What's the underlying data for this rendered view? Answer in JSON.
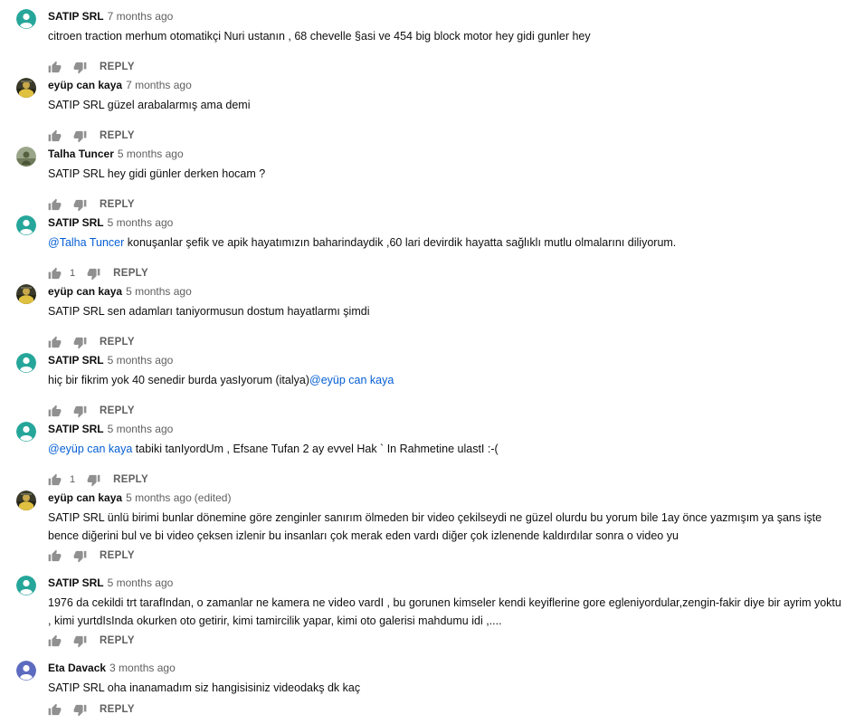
{
  "reply_label": "REPLY",
  "colors": {
    "teal_avatar": "#26a69a",
    "purple_avatar": "#5c6bc0",
    "mention": "#065fd4"
  },
  "comments": [
    {
      "author": "SATIP SRL",
      "time": "7 months ago",
      "avatar": "teal-default",
      "text_before": "citroen traction merhum otomatikçi Nuri ustanın , 68 chevelle §asi ve 454 big block motor hey gidi gunler hey"
    },
    {
      "author": "eyüp can kaya",
      "time": "7 months ago",
      "avatar": "photo-dark",
      "text_before": "SATIP SRL güzel arabalarmış ama demi"
    },
    {
      "author": "Talha Tuncer",
      "time": "5 months ago",
      "avatar": "photo-green",
      "text_before": "SATIP SRL hey gidi günler derken hocam ?"
    },
    {
      "author": "SATIP SRL",
      "time": "5 months ago",
      "avatar": "teal-default",
      "mention": "@Talha Tuncer",
      "text_after": " konuşanlar şefik ve apik hayatımızın baharindaydik ,60 lari devirdik hayatta sağlıklı mutlu olmalarını diliyorum.",
      "likes": "1"
    },
    {
      "author": "eyüp can kaya",
      "time": "5 months ago",
      "avatar": "photo-dark",
      "text_before": "SATIP SRL sen adamları taniyormusun dostum hayatlarmı şimdi"
    },
    {
      "author": "SATIP SRL",
      "time": "5 months ago",
      "avatar": "teal-default",
      "text_before": "hiç bir fikrim yok  40 senedir burda yasIyorum (italya)",
      "mention": "@eyüp can kaya"
    },
    {
      "author": "SATIP SRL",
      "time": "5 months ago",
      "avatar": "teal-default",
      "mention": "@eyüp can kaya",
      "text_after": " tabiki tanIyordUm , Efsane Tufan 2 ay evvel Hak ` In Rahmetine ulastI :-(",
      "likes": "1"
    },
    {
      "author": "eyüp can kaya",
      "time": "5 months ago",
      "edited": "(edited)",
      "avatar": "photo-dark",
      "text_before": "SATIP SRL ünlü birimi bunlar dönemine göre zenginler sanırım ölmeden bir video çekilseydi ne güzel olurdu bu yorum bile 1ay önce yazmışım ya şans işte bence diğerini bul ve bi video çeksen izlenir bu insanları çok merak eden vardı diğer çok izlenende kaldırdılar sonra o video yu"
    },
    {
      "author": "SATIP SRL",
      "time": "5 months ago",
      "avatar": "teal-default",
      "text_before": "1976 da cekildi  trt tarafIndan, o zamanlar ne kamera ne video vardI , bu gorunen kimseler kendi keyiflerine gore egleniyordular,zengin-fakir diye bir ayrim yoktu , kimi yurtdIsInda okurken oto getirir, kimi tamircilik yapar, kimi oto galerisi mahdumu idi ,...."
    },
    {
      "author": "Eta Davack",
      "time": "3 months ago",
      "avatar": "purple-default",
      "text_before": "SATIP SRL oha inanamadım siz hangisisiniz videodakş dk kaç"
    }
  ]
}
